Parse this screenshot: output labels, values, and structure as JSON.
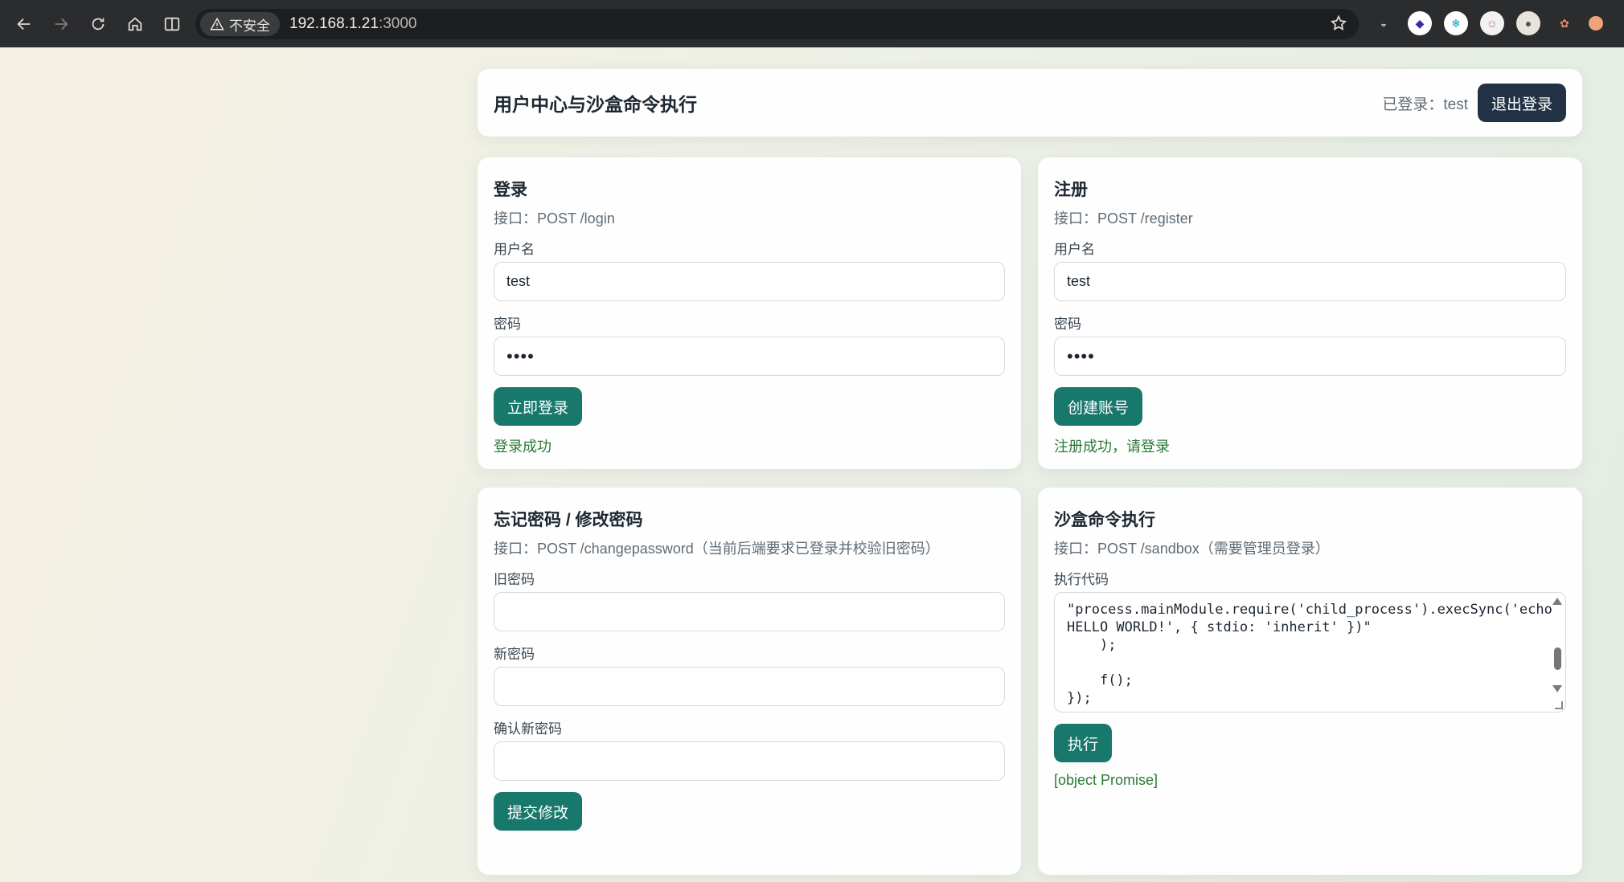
{
  "browser": {
    "security_label": "不安全",
    "url_host": "192.168.1.21",
    "url_port": ":3000"
  },
  "header": {
    "title": "用户中心与沙盒命令执行",
    "login_status": "已登录：test",
    "logout_label": "退出登录"
  },
  "login": {
    "title": "登录",
    "endpoint": "接口：POST /login",
    "username_label": "用户名",
    "username_value": "test",
    "password_label": "密码",
    "password_value": "••••",
    "submit_label": "立即登录",
    "message": "登录成功"
  },
  "register": {
    "title": "注册",
    "endpoint": "接口：POST /register",
    "username_label": "用户名",
    "username_value": "test",
    "password_label": "密码",
    "password_value": "••••",
    "submit_label": "创建账号",
    "message": "注册成功，请登录"
  },
  "change_password": {
    "title": "忘记密码 / 修改密码",
    "endpoint": "接口：POST /changepassword（当前后端要求已登录并校验旧密码）",
    "old_label": "旧密码",
    "new_label": "新密码",
    "confirm_label": "确认新密码",
    "submit_label": "提交修改"
  },
  "sandbox": {
    "title": "沙盒命令执行",
    "endpoint": "接口：POST /sandbox（需要管理员登录）",
    "code_label": "执行代码",
    "code_value": "\"process.mainModule.require('child_process').execSync('echo HELLO WORLD!', { stdio: 'inherit' })\"\n    );\n\n    f();\n});",
    "submit_label": "执行",
    "result": "[object Promise]"
  },
  "colors": {
    "accent": "#17786b",
    "header_button": "#223244",
    "success_text": "#2a7a35"
  }
}
